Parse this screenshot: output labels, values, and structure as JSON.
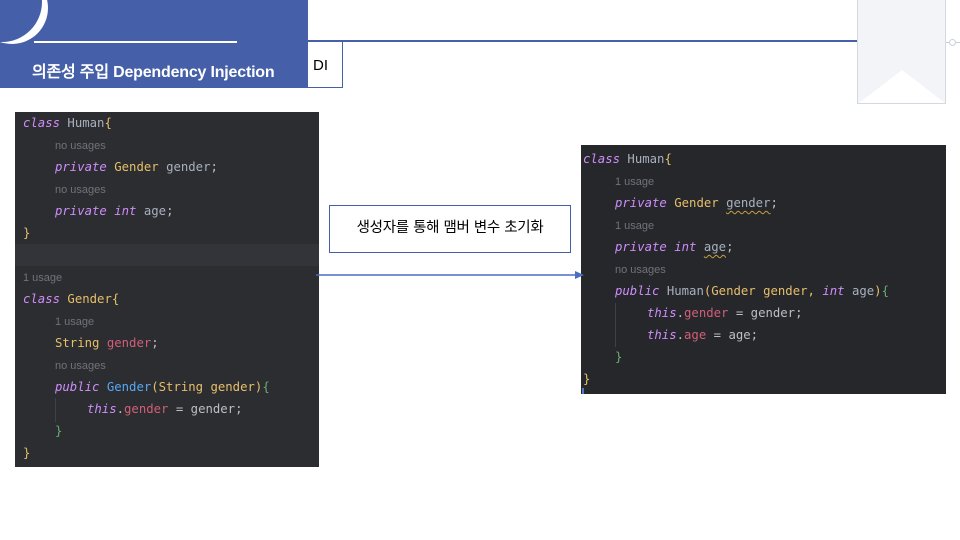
{
  "header": {
    "title": "의존성 주입 Dependency Injection",
    "tag": "DI",
    "accent_color": "#4560a8"
  },
  "left_code": {
    "lines": [
      [
        {
          "t": "class ",
          "c": "kw"
        },
        {
          "t": "Human",
          "c": "hum"
        },
        {
          "t": "{",
          "c": "brace-y"
        }
      ],
      [
        {
          "t": "no usages",
          "c": "hint"
        }
      ],
      [
        {
          "t": "private ",
          "c": "kw"
        },
        {
          "t": "Gender ",
          "c": "type"
        },
        {
          "t": "gender",
          "c": "hum"
        },
        {
          "t": ";",
          "c": "var"
        }
      ],
      [
        {
          "t": "no usages",
          "c": "hint"
        }
      ],
      [
        {
          "t": "private ",
          "c": "kw"
        },
        {
          "t": "int ",
          "c": "kw"
        },
        {
          "t": "age",
          "c": "hum"
        },
        {
          "t": ";",
          "c": "var"
        }
      ],
      [
        {
          "t": "}",
          "c": "brace-y"
        }
      ],
      [],
      [
        {
          "t": "1 usage",
          "c": "hint"
        }
      ],
      [
        {
          "t": "class ",
          "c": "kw"
        },
        {
          "t": "Gender",
          "c": "type"
        },
        {
          "t": "{",
          "c": "brace-y"
        }
      ],
      [
        {
          "t": "1 usage",
          "c": "hint"
        }
      ],
      [
        {
          "t": "String ",
          "c": "type"
        },
        {
          "t": "gender",
          "c": "field"
        },
        {
          "t": ";",
          "c": "var"
        }
      ],
      [
        {
          "t": "no usages",
          "c": "hint"
        }
      ],
      [
        {
          "t": "public ",
          "c": "kw"
        },
        {
          "t": "Gender",
          "c": "fn"
        },
        {
          "t": "(String gender)",
          "c": "type"
        },
        {
          "t": "{",
          "c": "brace-g"
        }
      ],
      [
        {
          "t": "this",
          "c": "kw"
        },
        {
          "t": ".",
          "c": "var"
        },
        {
          "t": "gender",
          "c": "field"
        },
        {
          "t": " = gender;",
          "c": "var"
        }
      ],
      [
        {
          "t": "}",
          "c": "brace-g"
        }
      ],
      [
        {
          "t": "}",
          "c": "brace-y"
        }
      ]
    ]
  },
  "right_code": {
    "lines": [
      [
        {
          "t": "class ",
          "c": "kw"
        },
        {
          "t": "Human",
          "c": "hum"
        },
        {
          "t": "{",
          "c": "brace-y"
        }
      ],
      [
        {
          "t": "1 usage",
          "c": "hint"
        }
      ],
      [
        {
          "t": "private ",
          "c": "kw"
        },
        {
          "t": "Gender ",
          "c": "type"
        },
        {
          "t": "gender",
          "c": "hum wavy"
        },
        {
          "t": ";",
          "c": "var"
        }
      ],
      [
        {
          "t": "1 usage",
          "c": "hint"
        }
      ],
      [
        {
          "t": "private ",
          "c": "kw"
        },
        {
          "t": "int ",
          "c": "kw"
        },
        {
          "t": "age",
          "c": "hum wavy"
        },
        {
          "t": ";",
          "c": "var"
        }
      ],
      [
        {
          "t": "no usages",
          "c": "hint"
        }
      ],
      [
        {
          "t": "public ",
          "c": "kw"
        },
        {
          "t": "Human",
          "c": "hum"
        },
        {
          "t": "(Gender gender, ",
          "c": "type"
        },
        {
          "t": "int ",
          "c": "kw"
        },
        {
          "t": "age",
          "c": "hum"
        },
        {
          "t": ")",
          "c": "type"
        },
        {
          "t": "{",
          "c": "brace-g"
        }
      ],
      [
        {
          "t": "this",
          "c": "kw"
        },
        {
          "t": ".",
          "c": "var"
        },
        {
          "t": "gender",
          "c": "field"
        },
        {
          "t": " = gender;",
          "c": "var"
        }
      ],
      [
        {
          "t": "this",
          "c": "kw"
        },
        {
          "t": ".",
          "c": "var"
        },
        {
          "t": "age",
          "c": "field"
        },
        {
          "t": " = age;",
          "c": "var"
        }
      ],
      [
        {
          "t": "}",
          "c": "brace-g"
        }
      ],
      [
        {
          "t": "}",
          "c": "brace-y"
        }
      ]
    ]
  },
  "callout": {
    "text": "생성자를 통해 맴버 변수 초기화"
  },
  "arrow_color": "#4a6fbf"
}
